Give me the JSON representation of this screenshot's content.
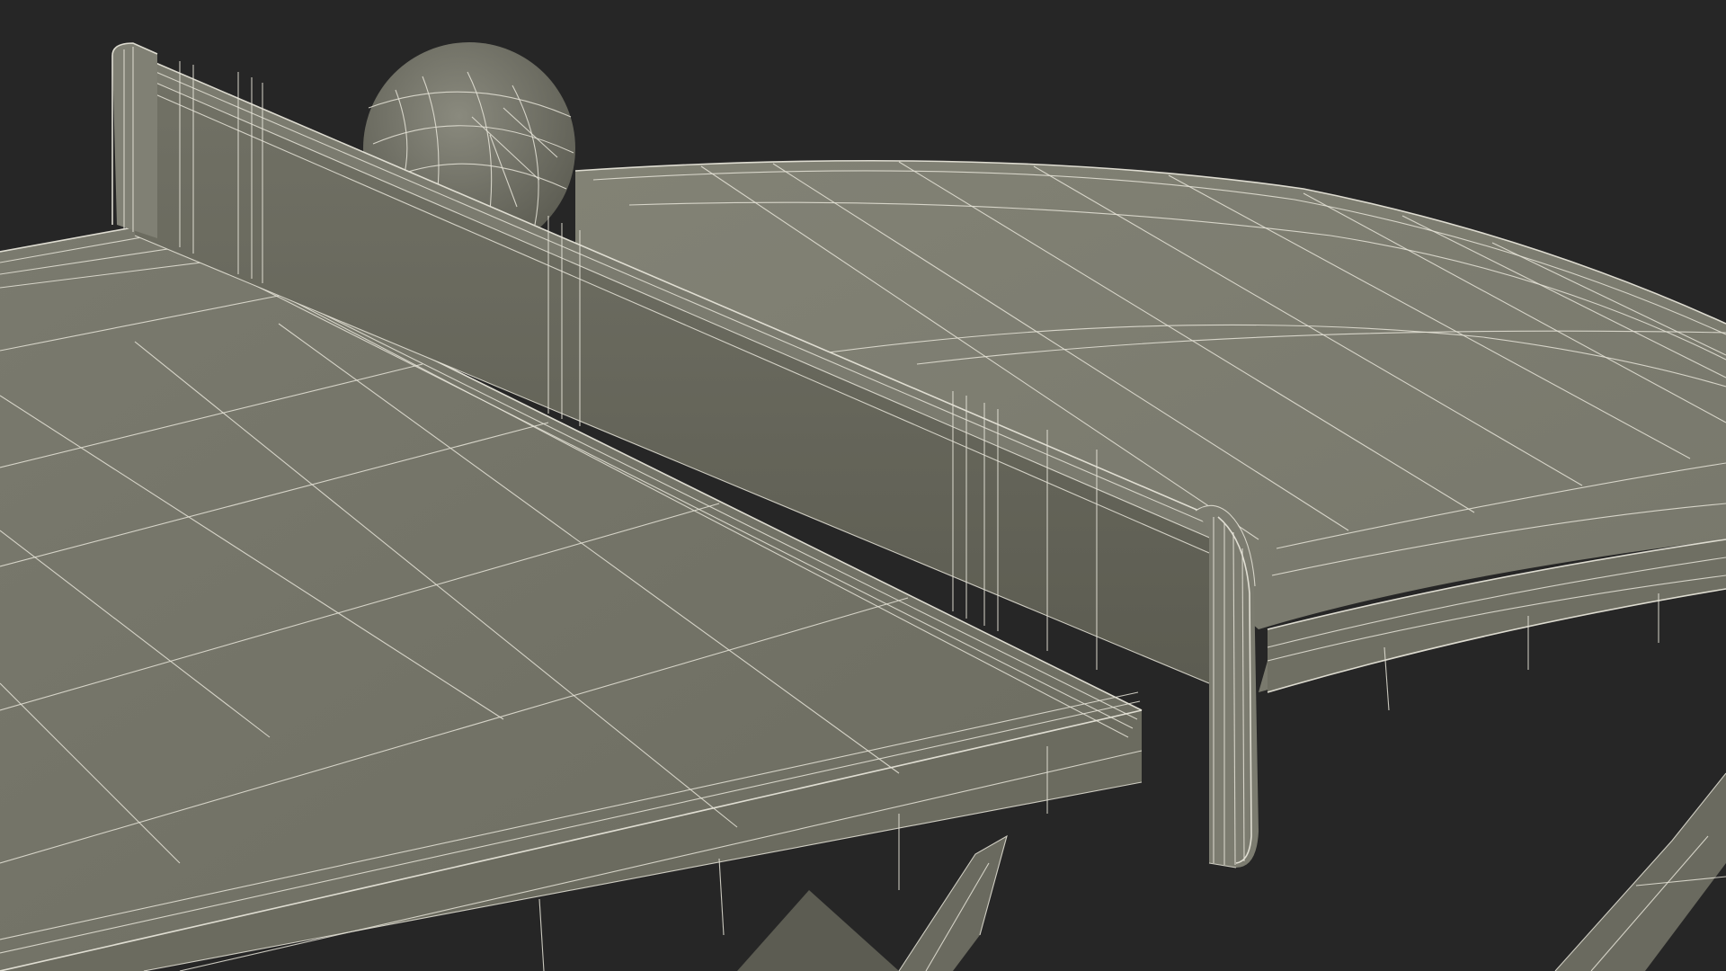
{
  "scene": {
    "subject": "ping-pong-table-wireframe-render",
    "colors": {
      "background": "#262626",
      "surface": "#767669",
      "surface_dark": "#5e5e53",
      "surface_edge": "#8a8a7d",
      "wireframe": "#e6e4d8"
    },
    "parts": [
      "tabletop-near",
      "tabletop-far",
      "net",
      "net-post-left",
      "net-post-right",
      "ball",
      "table-leg-left",
      "table-leg-right"
    ]
  }
}
